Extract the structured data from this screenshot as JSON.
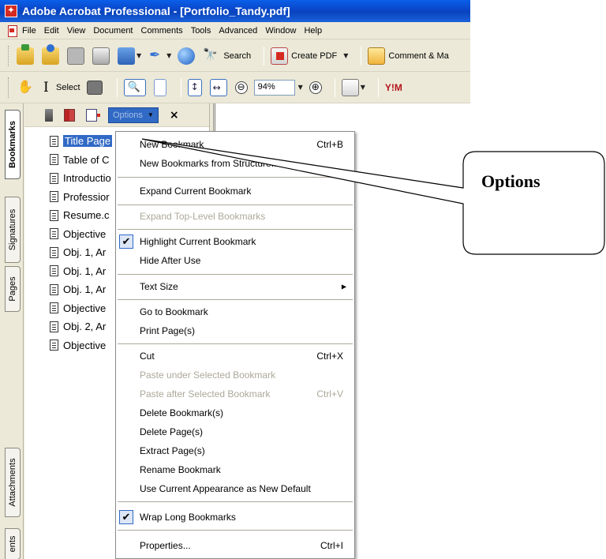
{
  "window": {
    "title": "Adobe Acrobat Professional - [Portfolio_Tandy.pdf]",
    "menu": [
      "File",
      "Edit",
      "View",
      "Document",
      "Comments",
      "Tools",
      "Advanced",
      "Window",
      "Help"
    ]
  },
  "toolbar1": {
    "search_label": "Search",
    "create_pdf_label": "Create PDF",
    "comment_label": "Comment & Ma"
  },
  "toolbar2": {
    "select_label": "Select",
    "zoom_value": "94%",
    "zoom_out_symbol": "⊖",
    "zoom_in_symbol": "⊕",
    "yahoo_label": "Y!M"
  },
  "nav_tabs": [
    "Bookmarks",
    "Signatures",
    "Pages",
    "Attachments",
    "ents"
  ],
  "bookmarks_panel": {
    "options_label": "Options",
    "close_label": "×",
    "items": [
      "Title Page",
      "Table of C",
      "Introductio",
      "Professior",
      "Resume.c",
      "Objective",
      "Obj. 1, Ar",
      "Obj. 1, Ar",
      "Obj. 1, Ar",
      "Objective",
      "Obj. 2, Ar",
      "Objective"
    ]
  },
  "options_menu": {
    "items": [
      {
        "label": "New Bookmark",
        "shortcut": "Ctrl+B"
      },
      {
        "label": "New Bookmarks from Structure..."
      },
      {
        "label": "Expand Current Bookmark"
      },
      {
        "label": "Expand Top-Level Bookmarks",
        "disabled": true
      },
      {
        "label": "Highlight Current Bookmark",
        "checked": true
      },
      {
        "label": "Hide After Use"
      },
      {
        "label": "Text Size",
        "submenu": true
      },
      {
        "label": "Go to Bookmark"
      },
      {
        "label": "Print Page(s)"
      },
      {
        "label": "Cut",
        "shortcut": "Ctrl+X"
      },
      {
        "label": "Paste under Selected Bookmark",
        "disabled": true
      },
      {
        "label": "Paste after Selected Bookmark",
        "shortcut": "Ctrl+V",
        "disabled": true
      },
      {
        "label": "Delete Bookmark(s)"
      },
      {
        "label": "Delete Page(s)"
      },
      {
        "label": "Extract Page(s)"
      },
      {
        "label": "Rename Bookmark"
      },
      {
        "label": "Use Current Appearance as New Default"
      },
      {
        "label": "Wrap Long Bookmarks",
        "checked": true
      },
      {
        "label": "Properties...",
        "shortcut": "Ctrl+I"
      }
    ]
  },
  "callout": {
    "label": "Options"
  },
  "colors": {
    "titlebar": "#0a46c8",
    "selection": "#316ac5",
    "chrome": "#ece9d8",
    "disabled_text": "#aca899"
  }
}
